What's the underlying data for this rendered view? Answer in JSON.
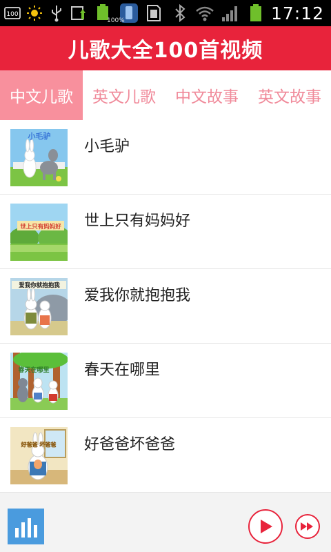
{
  "status_bar": {
    "left_icons": [
      "sim-100-icon",
      "brightness-icon",
      "usb-icon",
      "sync-icon",
      "battery-status-icon",
      "phone-icon",
      "sd-card-icon"
    ],
    "battery_percent_label": "100%",
    "right_icons": [
      "bluetooth-icon",
      "wifi-icon",
      "signal-icon",
      "battery-icon"
    ],
    "time": "17:12"
  },
  "header": {
    "title": "儿歌大全100首视频",
    "color": "#e8233b"
  },
  "tabs": [
    {
      "label": "中文儿歌",
      "active": true
    },
    {
      "label": "英文儿歌",
      "active": false
    },
    {
      "label": "中文故事",
      "active": false
    },
    {
      "label": "英文故事",
      "active": false
    }
  ],
  "songs": [
    {
      "title": "小毛驴",
      "thumb_caption": "小毛驴"
    },
    {
      "title": "世上只有妈妈好",
      "thumb_caption": "世上只有妈妈好"
    },
    {
      "title": "爱我你就抱抱我",
      "thumb_caption": "爱我你就抱抱我"
    },
    {
      "title": "春天在哪里",
      "thumb_caption": "春天在哪里"
    },
    {
      "title": "好爸爸坏爸爸",
      "thumb_caption": "好爸爸 坏爸爸"
    }
  ],
  "player": {
    "equalizer_icon": "equalizer-icon",
    "play_icon": "play-icon",
    "fast_forward_icon": "fast-forward-icon",
    "accent": "#e8233b"
  }
}
